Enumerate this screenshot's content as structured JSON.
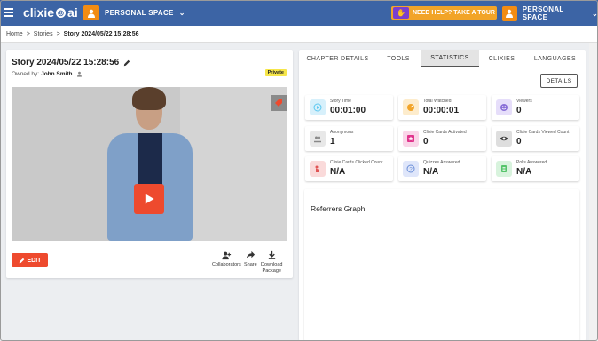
{
  "header": {
    "logo_text": "clixie",
    "logo_suffix": "ai",
    "workspace_left": "PERSONAL SPACE",
    "help_tour": "NEED HELP? TAKE A TOUR",
    "workspace_right": "PERSONAL SPACE",
    "brand_color": "#3c64a5",
    "accent_color": "#f28c13"
  },
  "breadcrumb": {
    "home": "Home",
    "sep1": ">",
    "stories": "Stories",
    "sep2": ">",
    "current": "Story 2024/05/22 15:28:56"
  },
  "story": {
    "title": "Story 2024/05/22 15:28:56",
    "owned_by_label": "Owned by:",
    "owner": "John Smith",
    "badge": "Private"
  },
  "actions": {
    "edit": "EDIT",
    "collaborators": "Collaborators",
    "share": "Share",
    "download_line1": "Download",
    "download_line2": "Package"
  },
  "tabs": [
    {
      "label": "CHAPTER DETAILS",
      "active": false
    },
    {
      "label": "TOOLS",
      "active": false
    },
    {
      "label": "STATISTICS",
      "active": true
    },
    {
      "label": "CLIXIES",
      "active": false
    },
    {
      "label": "LANGUAGES",
      "active": false
    }
  ],
  "details_button": "DETAILS",
  "stats": [
    {
      "label": "Story Time",
      "value": "00:01:00",
      "icon": "play-circle-icon",
      "color": "#5bc8f0"
    },
    {
      "label": "Total Watched",
      "value": "00:00:01",
      "icon": "timer-icon",
      "color": "#f2a428"
    },
    {
      "label": "Viewers",
      "value": "0",
      "icon": "viewers-icon",
      "color": "#8a6fd8"
    },
    {
      "label": "Anonymous",
      "value": "1",
      "icon": "anonymous-icon",
      "color": "#9a9a9a"
    },
    {
      "label": "Clixie Cards Activated",
      "value": "0",
      "icon": "cards-activated-icon",
      "color": "#e0338c"
    },
    {
      "label": "Clixie Cards Viewed Count",
      "value": "0",
      "icon": "eye-icon",
      "color": "#444444"
    },
    {
      "label": "Clixie Cards Clicked Count",
      "value": "N/A",
      "icon": "click-icon",
      "color": "#e05555"
    },
    {
      "label": "Quizzes Answered",
      "value": "N/A",
      "icon": "quiz-icon",
      "color": "#6b8fd8"
    },
    {
      "label": "Polls Answered",
      "value": "N/A",
      "icon": "poll-icon",
      "color": "#55c46a"
    }
  ],
  "referrers": {
    "title": "Referrers Graph"
  }
}
